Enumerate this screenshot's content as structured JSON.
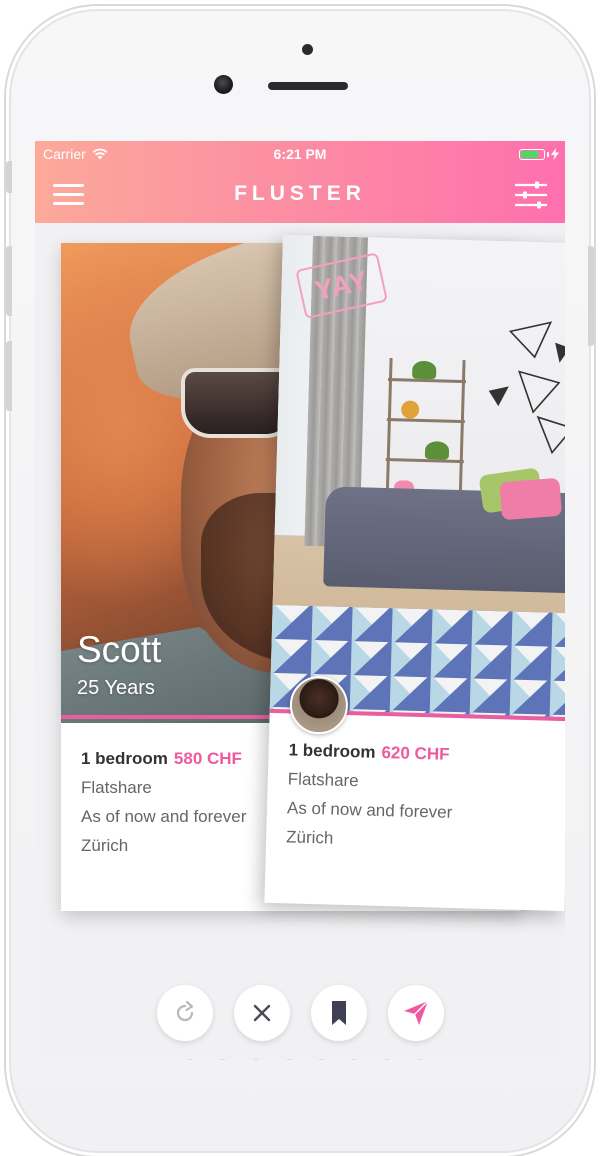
{
  "status_bar": {
    "carrier": "Carrier",
    "time": "6:21 PM",
    "battery_color": "#4cd964"
  },
  "header": {
    "title": "FLUSTER",
    "menu_icon": "hamburger-menu-icon",
    "filter_icon": "sliders-filter-icon",
    "gradient_start": "#fca99a",
    "gradient_end": "#ff6fae"
  },
  "cards": {
    "back": {
      "name": "Scott",
      "age": "25 Years",
      "bedrooms": "1 bedroom",
      "price": "580 CHF",
      "type": "Flatshare",
      "availability": "As of now and forever",
      "city": "Zürich"
    },
    "front": {
      "stamp": "YAY",
      "bedrooms": "1 bedroom",
      "price": "620 CHF",
      "type": "Flatshare",
      "availability": "As of now and forever",
      "city": "Zürich"
    }
  },
  "actions": [
    {
      "icon": "undo-icon"
    },
    {
      "icon": "close-icon"
    },
    {
      "icon": "bookmark-icon"
    },
    {
      "icon": "send-icon"
    }
  ],
  "accent_color": "#ef5a9e"
}
